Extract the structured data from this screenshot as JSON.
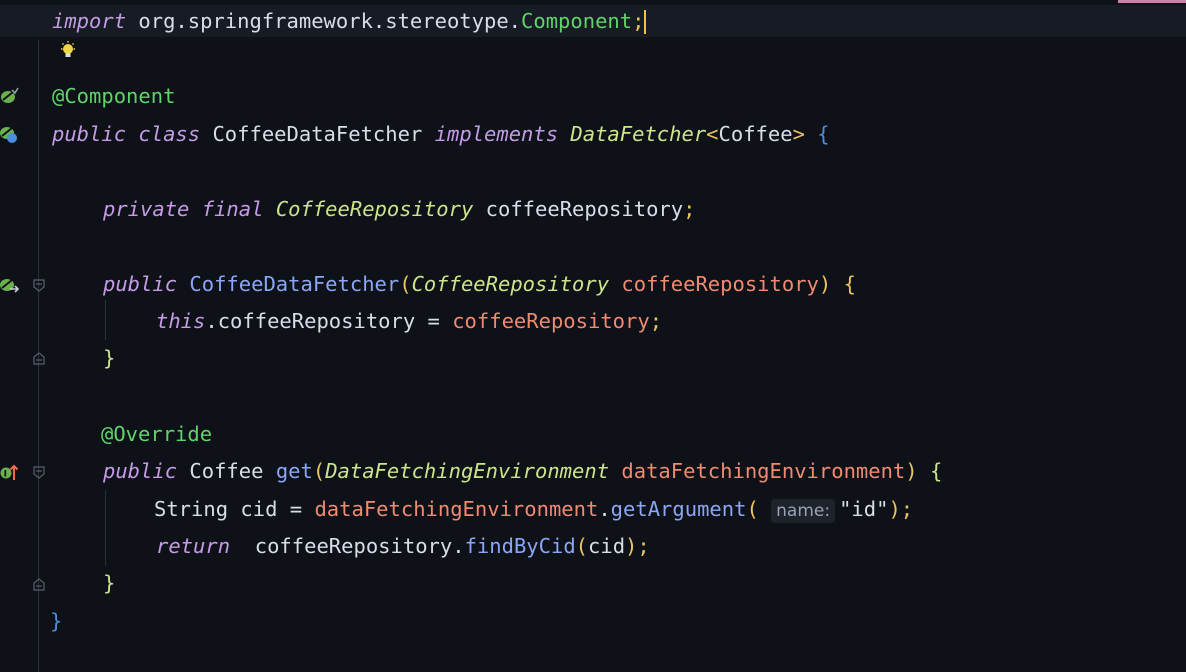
{
  "editor": {
    "lines": {
      "import_kw": "import",
      "import_pkg": "org.springframework.stereotype.",
      "import_class": "Component",
      "import_semi": ";",
      "annotation_component": "@Component",
      "class_public": "public",
      "class_kw": "class",
      "class_name": "CoffeeDataFetcher",
      "class_implements": "implements",
      "class_iface": "DataFetcher",
      "class_lt": "<",
      "class_generic": "Coffee",
      "class_gt": ">",
      "class_brace": "{",
      "field_private": "private",
      "field_final": "final",
      "field_type": "CoffeeRepository",
      "field_name": "coffeeRepository",
      "field_semi": ";",
      "ctor_public": "public",
      "ctor_name": "CoffeeDataFetcher",
      "ctor_paren_open": "(",
      "ctor_param_type": "CoffeeRepository",
      "ctor_param_name": "coffeeRepository",
      "ctor_paren_close": ")",
      "ctor_brace": "{",
      "assign_this": "this",
      "assign_field": ".coffeeRepository = ",
      "assign_value": "coffeeRepository",
      "assign_semi": ";",
      "ctor_close": "}",
      "override": "@Override",
      "get_public": "public",
      "get_return_type": "Coffee",
      "get_name": "get",
      "get_paren_open": "(",
      "get_param_type": "DataFetchingEnvironment",
      "get_param_name": "dataFetchingEnvironment",
      "get_paren_close": ")",
      "get_brace": "{",
      "cid_decl": "String cid = ",
      "cid_obj": "dataFetchingEnvironment",
      "cid_dot": ".",
      "cid_method": "getArgument",
      "cid_paren_open": "(",
      "cid_hint": "name:",
      "cid_arg": "\"id\"",
      "cid_paren_close": ")",
      "cid_semi": ";",
      "return_kw": "return",
      "return_obj": "coffeeRepository",
      "return_dot": ".",
      "return_method": "findByCid",
      "return_paren_open": "(",
      "return_arg": "cid",
      "return_paren_close": ")",
      "return_semi": ";",
      "get_close": "}",
      "class_close": "}"
    },
    "gutter_icons": [
      "intention-bulb-icon",
      "spring-bean-icon",
      "spring-bean-class-icon",
      "spring-autowire-icon",
      "override-method-icon"
    ],
    "colors": {
      "background": "#0e1117",
      "keyword": "#c59be6",
      "type": "#cfe28c",
      "annotation": "#5fd46a",
      "function": "#8aa6f5",
      "parameter": "#f08a70",
      "caret": "#f0c040"
    }
  }
}
